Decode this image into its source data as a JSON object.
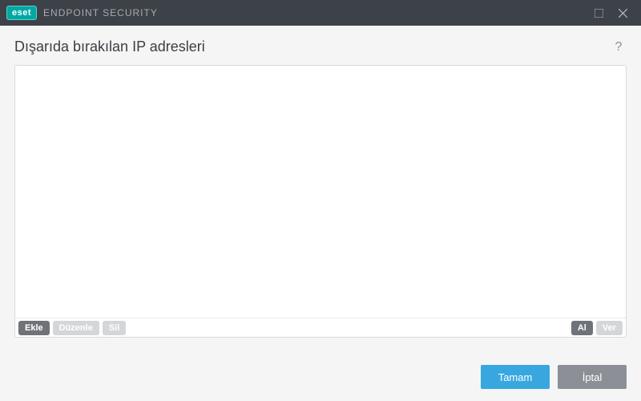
{
  "titlebar": {
    "logo_text": "eset",
    "app_title": "ENDPOINT SECURITY"
  },
  "header": {
    "page_title": "Dışarıda bırakılan IP adresleri",
    "help_label": "?"
  },
  "list": {
    "items": []
  },
  "list_toolbar": {
    "add_label": "Ekle",
    "edit_label": "Düzenle",
    "delete_label": "Sil",
    "import_label": "Al",
    "export_label": "Ver"
  },
  "footer": {
    "ok_label": "Tamam",
    "cancel_label": "İptal"
  }
}
